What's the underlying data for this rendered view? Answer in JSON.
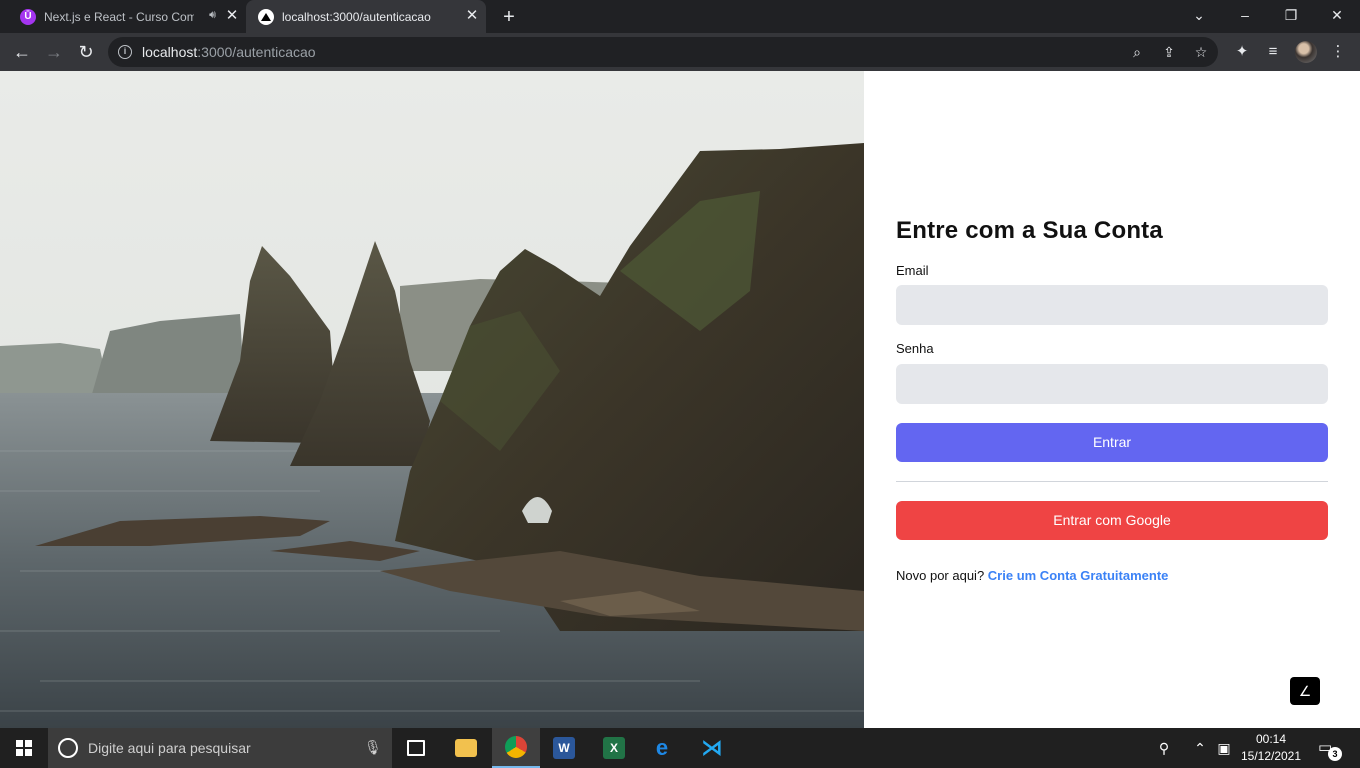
{
  "browser": {
    "tabs": [
      {
        "title": "Next.js e React - Curso Comp",
        "favicon": "udemy-icon",
        "audio": true,
        "active": false
      },
      {
        "title": "localhost:3000/autenticacao",
        "favicon": "nextjs-icon",
        "active": true
      }
    ],
    "url_host": "localhost",
    "url_rest": ":3000/autenticacao"
  },
  "page": {
    "heading": "Entre com a Sua Conta",
    "email_label": "Email",
    "email_value": "",
    "password_label": "Senha",
    "password_value": "",
    "submit_label": "Entrar",
    "google_label": "Entrar com Google",
    "signup_prompt": "Novo por aqui?",
    "signup_link": "Crie um Conta Gratuitamente",
    "colors": {
      "primary": "#6366f1",
      "google": "#ef4444",
      "link": "#3b82f6",
      "input_bg": "#e5e7eb"
    }
  },
  "taskbar": {
    "search_placeholder": "Digite aqui para pesquisar",
    "time": "00:14",
    "date": "15/12/2021",
    "notification_count": "3",
    "apps": [
      "task-view-icon",
      "file-explorer-icon",
      "chrome-icon",
      "word-icon",
      "excel-icon",
      "edge-icon",
      "vscode-icon"
    ]
  }
}
